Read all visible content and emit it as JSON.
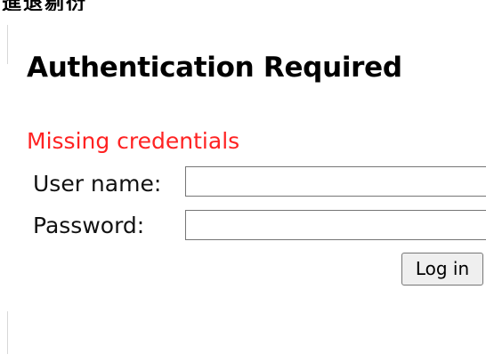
{
  "page": {
    "top_fragment": "進退剔衍垩垩",
    "title": "Authentication Required",
    "error_message": "Missing credentials"
  },
  "form": {
    "username_label": "User name:",
    "username_value": "",
    "password_label": "Password:",
    "password_value": "",
    "submit_label": "Log in"
  },
  "colors": {
    "error": "#ff2222",
    "background": "#ffffff"
  }
}
